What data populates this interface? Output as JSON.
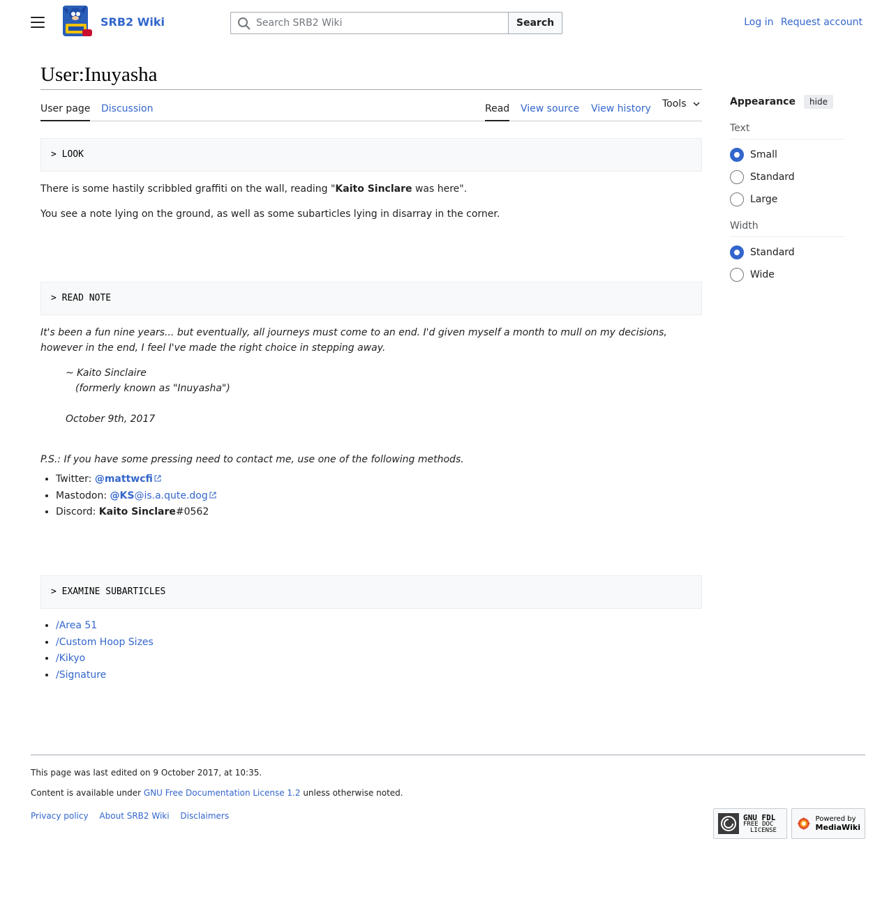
{
  "header": {
    "site_name": "SRB2 Wiki",
    "search_placeholder": "Search SRB2 Wiki",
    "search_button": "Search",
    "login": "Log in",
    "request_account": "Request account"
  },
  "page": {
    "title": "User:Inuyasha",
    "tabs": {
      "user_page": "User page",
      "discussion": "Discussion",
      "read": "Read",
      "view_source": "View source",
      "view_history": "View history",
      "tools": "Tools"
    }
  },
  "content": {
    "look": "> LOOK",
    "graffiti_pre": "There is some hastily scribbled graffiti on the wall, reading \"",
    "graffiti_name": "Kaito Sinclare",
    "graffiti_post": " was here\".",
    "note_line": "You see a note lying on the ground, as well as some subarticles lying in disarray in the corner.",
    "read_note": "> READ NOTE",
    "note_text_1": "It's been a fun nine years... but eventually, all journeys must come to an end. I'd given myself a month to mull on my decisions,",
    "note_text_2": "however in the end, I feel I've made the right choice in stepping away.",
    "signature_1": "~ Kaito Sinclaire",
    "signature_2": "(formerly known as \"Inuyasha\")",
    "date": "October 9th, 2017",
    "ps": "P.S.: If you have some pressing need to contact me, use one of the following methods.",
    "contacts": {
      "twitter_label": "Twitter: ",
      "twitter_link": "@mattwcfi",
      "mastodon_label": "Mastodon: ",
      "mastodon_bold": "@KS",
      "mastodon_rest": "@is.a.qute.dog",
      "discord_label": "Discord: ",
      "discord_bold": "Kaito Sinclare",
      "discord_rest": "#0562"
    },
    "examine": "> EXAMINE SUBARTICLES",
    "subarticles": [
      "/Area 51",
      "/Custom Hoop Sizes",
      "/Kikyo",
      "/Signature"
    ]
  },
  "appearance": {
    "title": "Appearance",
    "hide": "hide",
    "text_label": "Text",
    "text_options": [
      "Small",
      "Standard",
      "Large"
    ],
    "text_selected": "Small",
    "width_label": "Width",
    "width_options": [
      "Standard",
      "Wide"
    ],
    "width_selected": "Standard"
  },
  "footer": {
    "last_edited": "This page was last edited on 9 October 2017, at 10:35.",
    "license_pre": "Content is available under ",
    "license_link": "GNU Free Documentation License 1.2",
    "license_post": " unless otherwise noted.",
    "links": [
      "Privacy policy",
      "About SRB2 Wiki",
      "Disclaimers"
    ],
    "badge_gnu_1": "GNU FDL",
    "badge_gnu_2": "FREE DOC",
    "badge_gnu_3": "LICENSE",
    "badge_mw_1": "Powered by",
    "badge_mw_2": "MediaWiki"
  }
}
